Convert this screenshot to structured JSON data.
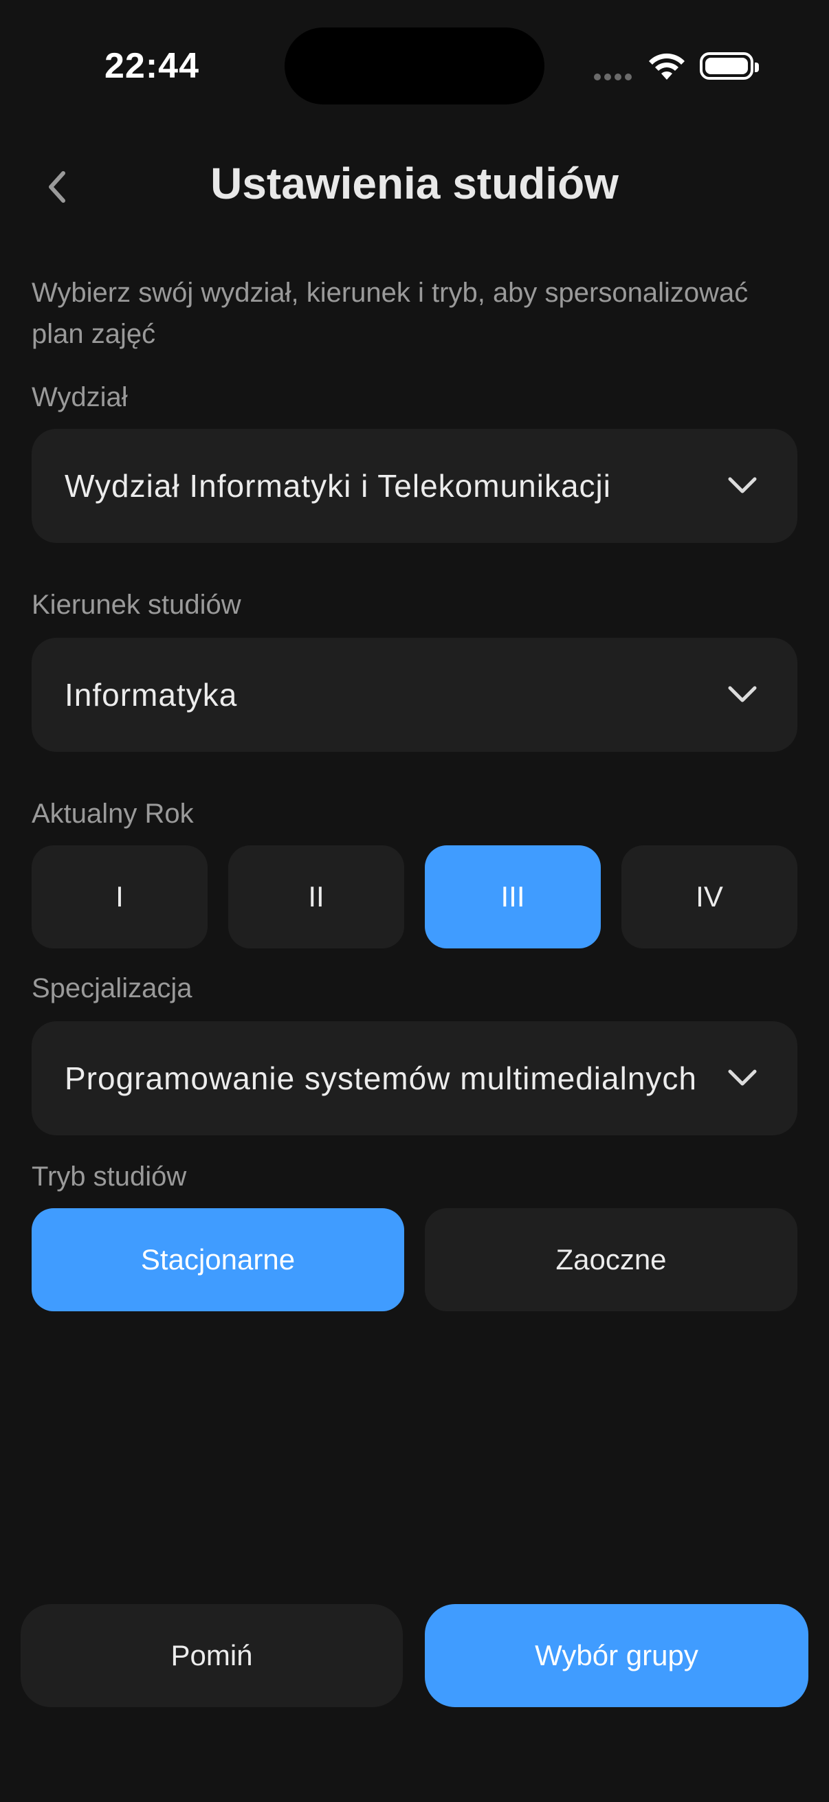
{
  "status_bar": {
    "time": "22:44",
    "icons": [
      "cellular-signal-icon",
      "wifi-icon",
      "battery-icon"
    ]
  },
  "header": {
    "title": "Ustawienia studiów",
    "back_icon": "chevron-left-icon"
  },
  "intro": "Wybierz swój wydział, kierunek i tryb, aby spersonalizować plan zajęć",
  "faculty": {
    "label": "Wydział",
    "value": "Wydział Informatyki i Telekomunikacji"
  },
  "field": {
    "label": "Kierunek studiów",
    "value": "Informatyka"
  },
  "year": {
    "label": "Aktualny Rok",
    "options": [
      "I",
      "II",
      "III",
      "IV"
    ],
    "selected": "III"
  },
  "specialization": {
    "label": "Specjalizacja",
    "value": "Programowanie systemów multimedialnych"
  },
  "mode": {
    "label": "Tryb studiów",
    "options": [
      "Stacjonarne",
      "Zaoczne"
    ],
    "selected": "Stacjonarne"
  },
  "footer": {
    "skip_label": "Pomiń",
    "next_label": "Wybór grupy"
  },
  "colors": {
    "background": "#131313",
    "surface": "#1f1f1f",
    "accent": "#409cff"
  }
}
